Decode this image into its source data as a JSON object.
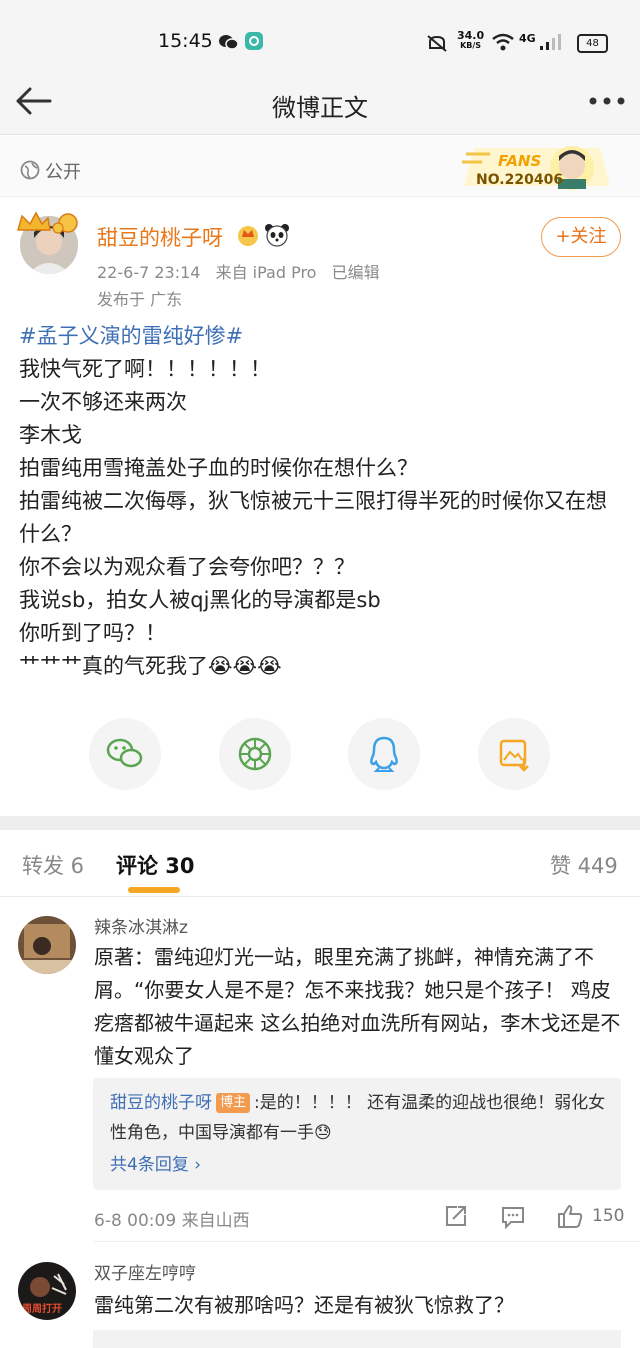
{
  "status_bar": {
    "time": "15:45",
    "net_speed_value": "34.0",
    "net_speed_unit": "KB/S",
    "battery": "48",
    "network": "4G"
  },
  "nav": {
    "title": "微博正文",
    "back_icon": "arrow-left-icon",
    "more_icon": "more-dots-icon"
  },
  "visibility": {
    "label": "公开",
    "fans_word": "FANS",
    "fans_no": "NO.220406"
  },
  "post": {
    "author": "甜豆的桃子呀",
    "time": "22-6-7 23:14",
    "source": "来自 iPad Pro",
    "edited": "已编辑",
    "location": "发布于 广东",
    "follow_label": "+关注",
    "topic": "#孟子义演的雷纯好惨#",
    "lines": [
      "我快气死了啊！！！！！！",
      "一次不够还来两次",
      "李木戈",
      "拍雷纯用雪掩盖处子血的时候你在想什么？",
      "拍雷纯被二次侮辱，狄飞惊被元十三限打得半死的时候你又在想什么？",
      "你不会以为观众看了会夸你吧？？？",
      "我说sb，拍女人被qj黑化的导演都是sb",
      "你听到了吗？！",
      "艹艹艹真的气死我了😭😭😭"
    ]
  },
  "share": [
    "wechat-icon",
    "moments-icon",
    "qq-icon",
    "save-image-icon"
  ],
  "tabs": {
    "repost": "转发 6",
    "comment": "评论 30",
    "like": "赞 449"
  },
  "comments": [
    {
      "user": "辣条冰淇淋z",
      "text": "原著：雷纯迎灯光一站，眼里充满了挑衅，神情充满了不屑。“你要女人是不是？怎不来找我？她只是个孩子！ 鸡皮疙瘩都被牛逼起来 这么拍绝对血洗所有网站，李木戈还是不懂女观众了",
      "reply_author": "甜豆的桃子呀",
      "reply_badge": "博主",
      "reply_text": ":是的！！！！ 还有温柔的迎战也很绝！弱化女性角色，中国导演都有一手😓",
      "reply_more": "共4条回复 ›",
      "meta": "6-8 00:09  来自山西",
      "likes": "150"
    },
    {
      "user": "双子座左哼哼",
      "text": "雷纯第二次有被那啥吗？还是有被狄飞惊救了？",
      "avatar_text": "周周打开"
    }
  ]
}
